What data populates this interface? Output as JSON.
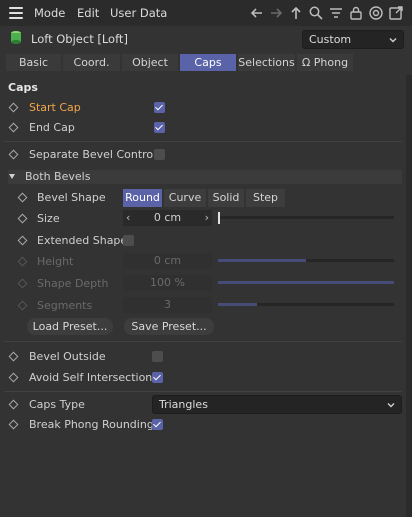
{
  "menubar": {
    "items": [
      "Mode",
      "Edit",
      "User Data"
    ]
  },
  "toolbar_icons": [
    "back-arrow-icon",
    "forward-arrow-icon",
    "up-arrow-icon",
    "search-icon",
    "filter-icon",
    "lock-icon",
    "target-icon",
    "open-new-window-icon"
  ],
  "object": {
    "title": "Loft Object [Loft]",
    "mode": "Custom"
  },
  "tabs": [
    {
      "label": "Basic",
      "active": false
    },
    {
      "label": "Coord.",
      "active": false
    },
    {
      "label": "Object",
      "active": false
    },
    {
      "label": "Caps",
      "active": true
    },
    {
      "label": "Selections",
      "active": false
    },
    {
      "label": "Phong",
      "icon": "Ω",
      "active": false
    }
  ],
  "section": {
    "title": "Caps"
  },
  "caps": {
    "start_cap": {
      "label": "Start Cap",
      "checked": true
    },
    "end_cap": {
      "label": "End Cap",
      "checked": true
    },
    "separate_bevel": {
      "label": "Separate Bevel Controls",
      "checked": false
    }
  },
  "both_bevels": {
    "title": "Both Bevels",
    "bevel_shape_label": "Bevel Shape",
    "bevel_shapes": [
      {
        "label": "Round",
        "active": true
      },
      {
        "label": "Curve",
        "active": false
      },
      {
        "label": "Solid",
        "active": false
      },
      {
        "label": "Step",
        "active": false
      }
    ],
    "size": {
      "label": "Size",
      "value": "0 cm",
      "left_arrow": "‹",
      "right_arrow": "›",
      "slider_fraction": 0.0
    },
    "extended_shape": {
      "label": "Extended Shape",
      "checked": false
    },
    "height": {
      "label": "Height",
      "value": "0 cm",
      "slider_fraction": 0.5
    },
    "shape_depth": {
      "label": "Shape Depth",
      "value": "100 %",
      "slider_fraction": 1.0
    },
    "segments": {
      "label": "Segments",
      "value": "3",
      "slider_fraction": 0.22
    },
    "load_preset": "Load Preset...",
    "save_preset": "Save Preset..."
  },
  "bevel_outside": {
    "label": "Bevel Outside",
    "checked": false
  },
  "avoid_self": {
    "label": "Avoid Self Intersections",
    "checked": true
  },
  "caps_type": {
    "label": "Caps Type",
    "value": "Triangles"
  },
  "break_phong": {
    "label": "Break Phong Rounding",
    "checked": true
  },
  "colors": {
    "accent": "#5a62a8",
    "orange_label": "#f0a64c",
    "background": "#333333"
  }
}
